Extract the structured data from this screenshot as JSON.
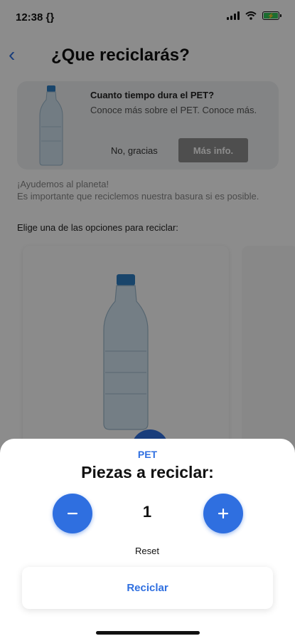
{
  "status_bar": {
    "time": "12:38 {}"
  },
  "nav": {
    "back_symbol": "‹",
    "title": "¿Que reciclarás?"
  },
  "info_card": {
    "title": "Cuanto tiempo dura el PET?",
    "description": "Conoce más sobre el PET. Conoce más.",
    "dismiss_label": "No, gracias",
    "more_label": "Más info."
  },
  "help_text": "¡Ayudemos al planeta!\nEs importante que reciclemos nuestra basura si es posible.",
  "instruction": "Elige una de las opciones para reciclar:",
  "sheet": {
    "category": "PET",
    "title": "Piezas a reciclar:",
    "count": "1",
    "reset_label": "Reset",
    "recycle_label": "Reciclar"
  },
  "colors": {
    "accent": "#2f6fe0",
    "battery": "#34c759"
  },
  "icons": [
    "back-chevron-icon",
    "signal-icon",
    "wifi-icon",
    "battery-icon",
    "bottle-icon",
    "minus-icon",
    "plus-icon"
  ]
}
